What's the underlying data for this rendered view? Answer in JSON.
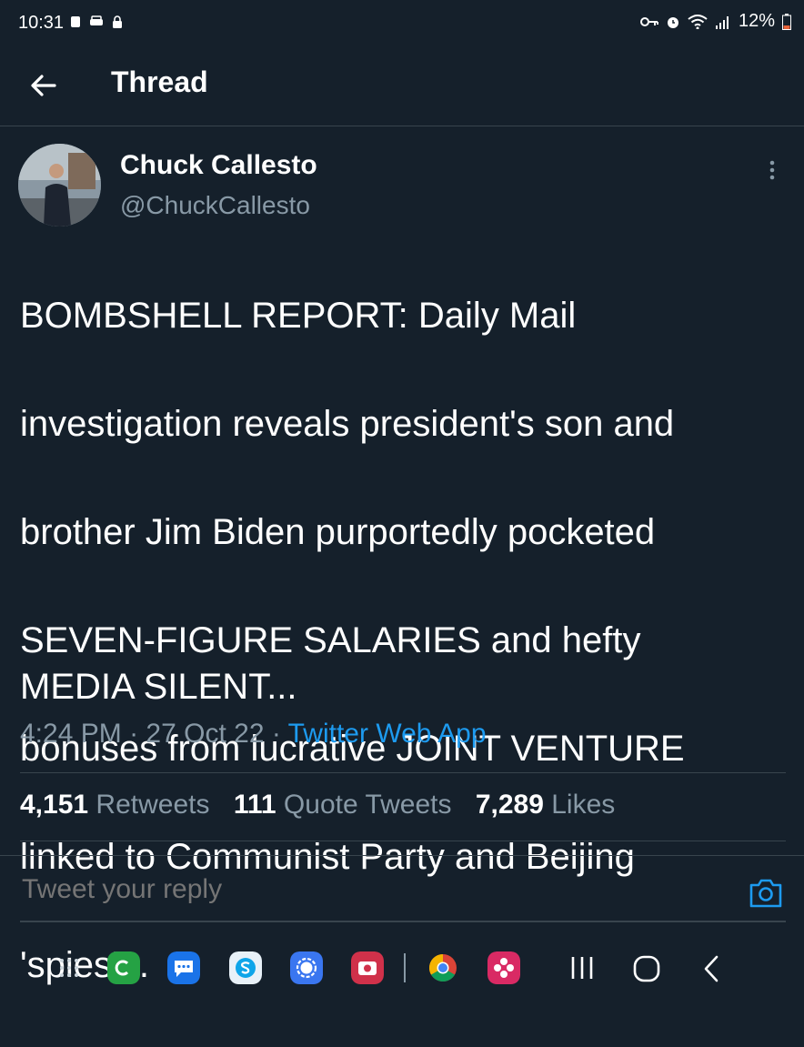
{
  "status_bar": {
    "time": "10:31",
    "battery": "12%"
  },
  "header": {
    "title": "Thread"
  },
  "tweet": {
    "author_name": "Chuck Callesto",
    "author_handle": "@ChuckCallesto",
    "lines": [
      "BOMBSHELL REPORT: Daily Mail",
      "investigation reveals president's son and",
      "brother Jim Biden purportedly pocketed",
      "SEVEN-FIGURE SALARIES and hefty",
      "bonuses from lucrative JOINT VENTURE",
      "linked to Communist Party and Beijing",
      "'spies'..."
    ],
    "closing": "MEDIA SILENT...",
    "time": "4:24 PM",
    "date": "27 Oct 22",
    "separator": "·",
    "source": "Twitter Web App"
  },
  "stats": {
    "retweets_count": "4,151",
    "retweets_label": "Retweets",
    "quotes_count": "111",
    "quotes_label": "Quote Tweets",
    "likes_count": "7,289",
    "likes_label": "Likes"
  },
  "reply": {
    "placeholder": "Tweet your reply"
  },
  "colors": {
    "background": "#15202b",
    "muted": "#8899a6",
    "accent": "#1d9bf0",
    "divider": "#38444d"
  },
  "icons": {
    "back": "arrow-left-icon",
    "more": "more-vertical-icon",
    "camera": "camera-icon",
    "nav_apps": [
      "app-drawer-icon",
      "whatsapp-business-icon",
      "messages-icon",
      "skype-icon",
      "signal-icon",
      "camera-app-icon",
      "chrome-icon",
      "flower-app-icon"
    ],
    "system_nav": [
      "recents-icon",
      "home-icon",
      "back-nav-icon"
    ]
  }
}
